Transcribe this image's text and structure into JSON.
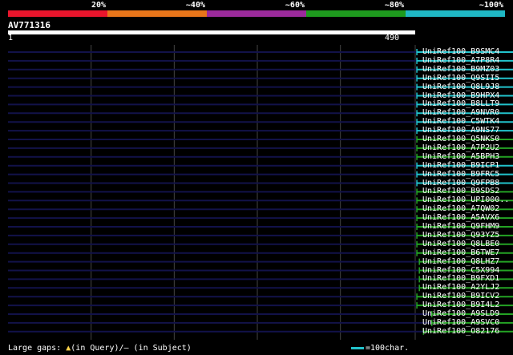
{
  "identity_scale": [
    {
      "label": "20%",
      "color": "#e8152c"
    },
    {
      "label": "~40%",
      "color": "#e8751a"
    },
    {
      "label": "~60%",
      "color": "#9b2a9b"
    },
    {
      "label": "~80%",
      "color": "#1e9a1e"
    },
    {
      "label": "~100%",
      "color": "#1fb7c4"
    }
  ],
  "query": {
    "name": "AV771316",
    "start": "1",
    "end": "490",
    "length": 490
  },
  "hits": [
    {
      "label": "UniRef100_B9SMC4",
      "color": "cyan",
      "start": 492,
      "end": 725
    },
    {
      "label": "UniRef100_A7P8R4",
      "color": "cyan",
      "start": 492,
      "end": 725
    },
    {
      "label": "UniRef100_B9MZ03",
      "color": "cyan",
      "start": 492,
      "end": 725
    },
    {
      "label": "UniRef100_Q9SII5",
      "color": "cyan",
      "start": 492,
      "end": 725
    },
    {
      "label": "UniRef100_Q8L9J8",
      "color": "cyan",
      "start": 492,
      "end": 725
    },
    {
      "label": "UniRef100_B9HPX4",
      "color": "cyan",
      "start": 492,
      "end": 725
    },
    {
      "label": "UniRef100_B8LLT9",
      "color": "cyan",
      "start": 492,
      "end": 725
    },
    {
      "label": "UniRef100_A9NVR0",
      "color": "cyan",
      "start": 492,
      "end": 725
    },
    {
      "label": "UniRef100_C5WTK4",
      "color": "cyan",
      "start": 492,
      "end": 725
    },
    {
      "label": "UniRef100_A9NS77",
      "color": "cyan",
      "start": 492,
      "end": 725
    },
    {
      "label": "UniRef100_Q5NKS0",
      "color": "green",
      "start": 492,
      "end": 725
    },
    {
      "label": "UniRef100_A7P2U2",
      "color": "green",
      "start": 492,
      "end": 725
    },
    {
      "label": "UniRef100_A5BPH3",
      "color": "green",
      "start": 492,
      "end": 725
    },
    {
      "label": "UniRef100_B9ICP1",
      "color": "cyan",
      "start": 492,
      "end": 725
    },
    {
      "label": "UniRef100_B9FRC5",
      "color": "cyan",
      "start": 492,
      "end": 725
    },
    {
      "label": "UniRef100_Q9FPB8",
      "color": "cyan",
      "start": 492,
      "end": 725
    },
    {
      "label": "UniRef100_B9SDS2",
      "color": "green",
      "start": 492,
      "end": 725
    },
    {
      "label": "UniRef100_UPI000..",
      "color": "green",
      "start": 492,
      "end": 725
    },
    {
      "label": "UniRef100_A7QW02",
      "color": "green",
      "start": 492,
      "end": 725
    },
    {
      "label": "UniRef100_A5AVX6",
      "color": "green",
      "start": 492,
      "end": 725
    },
    {
      "label": "UniRef100_Q9FHM9",
      "color": "green",
      "start": 492,
      "end": 725
    },
    {
      "label": "UniRef100_Q93YZ5",
      "color": "green",
      "start": 492,
      "end": 725
    },
    {
      "label": "UniRef100_Q8LBE0",
      "color": "green",
      "start": 492,
      "end": 725
    },
    {
      "label": "UniRef100_B6TWE7",
      "color": "green",
      "start": 492,
      "end": 725
    },
    {
      "label": "UniRef100_Q8LHZ7",
      "color": "green",
      "start": 495,
      "end": 725
    },
    {
      "label": "UniRef100_C5X994",
      "color": "green",
      "start": 495,
      "end": 725
    },
    {
      "label": "UniRef100_B9FXD1",
      "color": "green",
      "start": 495,
      "end": 725
    },
    {
      "label": "UniRef100_A2YLJ2",
      "color": "green",
      "start": 495,
      "end": 725
    },
    {
      "label": "UniRef100_B9ICV2",
      "color": "green",
      "start": 492,
      "end": 725
    },
    {
      "label": "UniRef100_B9I4L2",
      "color": "green",
      "start": 492,
      "end": 725
    },
    {
      "label": "UniRef100_A9SLD9",
      "color": "green",
      "start": 510,
      "end": 725
    },
    {
      "label": "UniRef100_A9SVC0",
      "color": "green",
      "start": 510,
      "end": 725
    },
    {
      "label": "UniRef100_O82176",
      "color": "green",
      "start": 500,
      "end": 725
    }
  ],
  "footer": {
    "gaps_prefix": "Large gaps: ",
    "gaps_icon": "▲",
    "gaps_text": "(in Query)/– (in Subject)",
    "scale_text": "=100char."
  },
  "colors": {
    "cyan": "#22c3cc",
    "green": "#24a324",
    "dark_line": "#12124a",
    "grid": "#444444"
  }
}
